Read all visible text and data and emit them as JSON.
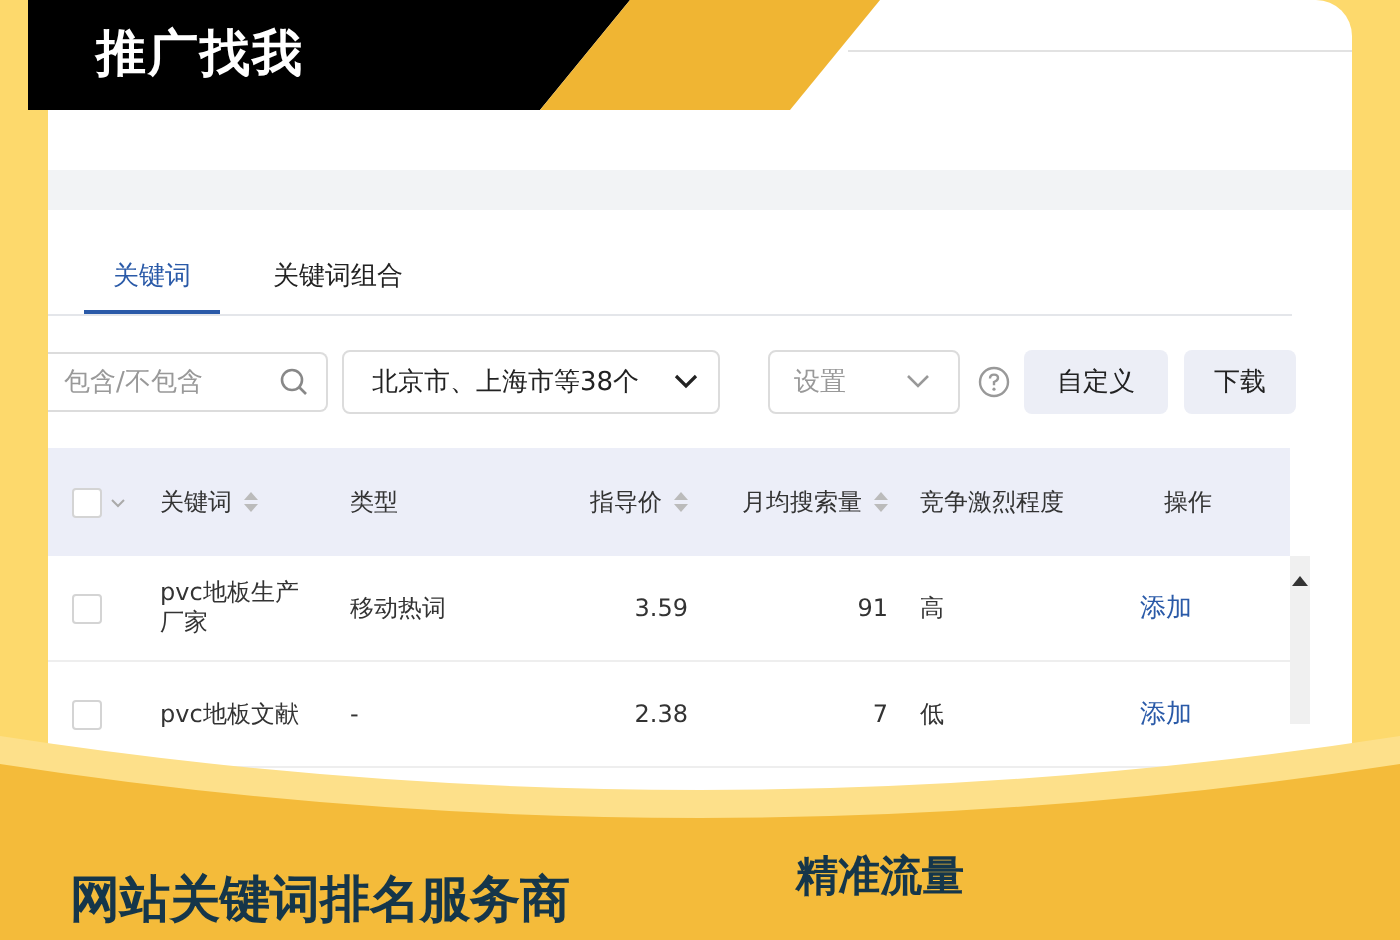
{
  "banner": {
    "title": "推广找我"
  },
  "tabs": [
    {
      "label": "关键词",
      "selected": true
    },
    {
      "label": "关键词组合",
      "selected": false
    }
  ],
  "filters": {
    "search": {
      "placeholder": "包含/不包含"
    },
    "region": {
      "value": "北京市、上海市等38个"
    },
    "settings": {
      "placeholder": "设置"
    },
    "buttons": [
      "自定义",
      "下载"
    ]
  },
  "table": {
    "header_checked": false,
    "columns": [
      {
        "label": "关键词",
        "sortable": true,
        "kind": "text"
      },
      {
        "label": "类型",
        "sortable": false,
        "kind": "text"
      },
      {
        "label": "指导价",
        "sortable": true,
        "kind": "number"
      },
      {
        "label": "月均搜索量",
        "sortable": true,
        "kind": "number"
      },
      {
        "label": "竞争激烈程度",
        "sortable": false,
        "kind": "text"
      },
      {
        "label": "操作",
        "sortable": false,
        "kind": "action"
      }
    ],
    "rows": [
      {
        "checked": false,
        "cells": [
          "pvc地板生产厂家",
          "移动热词",
          "3.59",
          "91",
          "高",
          "添加"
        ]
      },
      {
        "checked": false,
        "cells": [
          "pvc地板文献",
          "-",
          "2.38",
          "7",
          "低",
          "添加"
        ]
      }
    ]
  },
  "footer": {
    "headline": "网站关键词排名服务商",
    "slogan_lines": [
      "精准流量"
    ]
  }
}
